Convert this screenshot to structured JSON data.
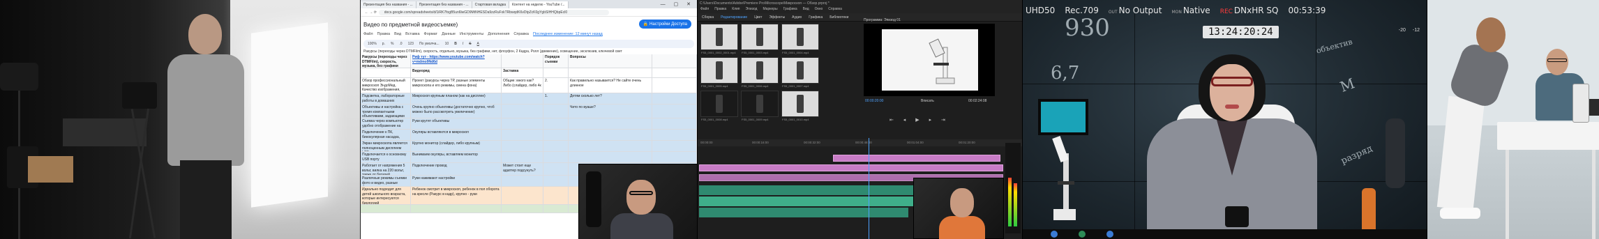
{
  "spreadsheet": {
    "tabs": [
      "Презентация без названия - ...",
      "Презентация без названия - ...",
      "Стартовая вкладка",
      "Контент на неделю - YouTube /..."
    ],
    "url": "docs.google.com/spreadsheets/d/1iRK7fogB5un6lwGD9MtNHESDa9zzRuFxkTRbwqdK6vDtpZcK0gYgbSIHHQbpEcl0",
    "title": "Видео по предметной видеосъемке)",
    "share_label": "Настройки Доступа",
    "menu": [
      "Файл",
      "Правка",
      "Вид",
      "Вставка",
      "Формат",
      "Данные",
      "Инструменты",
      "Дополнения",
      "Справка"
    ],
    "last_edit": "Последнее изменение: 12 минут назад",
    "toolbar": [
      "100%",
      "р.",
      "%",
      ".0",
      "123",
      "По умолча...",
      "10",
      "B",
      "I",
      "S",
      "A"
    ],
    "formula": "Ракурсы (переходы через DTMFilm), скорость, отдельно, музыка, без графики, нет, флоуфон, 2 Кадра, Ролл (движение), освещение, эксклюзив, ключевой свет",
    "headers": [
      "Ракурсы (переходы через DTMFilm), скорость, музыка, без графики",
      "Риф тут - https://www.youtube.com/watch?v=mdmo9Nd6d",
      "",
      "Порядок съемки",
      "Вопросы",
      ""
    ],
    "subheaders": [
      "",
      "Видеоряд",
      "Заставка",
      "",
      "",
      ""
    ],
    "rows": [
      {
        "c1": "Обзор профессиональный микроскоп ЭндоМед. Качество изображения, наличие, отзывы",
        "c2": "Проект (ракурсы через TP, разные элементы микроскопа и его режимы, смена фона)",
        "c3": "Общие: много как? Либо (слайдер, либо 4к",
        "c4": "2.",
        "c5": "Как правильно называется? Не сайте очень длинное",
        "color": ""
      },
      {
        "c1": "Подсветка, лабораторные работы в домашних условиях, медицинская лаборатория",
        "c2": "Микроскоп крупным планом (как на дисплее)",
        "c3": "",
        "c4": "1.",
        "c5": "Детям сколько лет?",
        "color": "blue"
      },
      {
        "c1": "Объективы и настройка с тремя компактными объективами, задающими увеличение",
        "c2": "Очень крупно объективы (достаточно крупно, чтоб можно было рассмотреть увеличение)",
        "c3": "",
        "c4": "",
        "c5": "Чито по вуаше?",
        "color": "blue"
      },
      {
        "c1": "Съемка через компьютер удобно отображение на широком полотне",
        "c2": "Руки крутят объективы",
        "c3": "",
        "c4": "",
        "c5": "",
        "color": "blue"
      },
      {
        "c1": "Подключение к ПК, бинокулярная насадка, мультимедиа",
        "c2": "Окуляры вставляются в микроскоп",
        "c3": "",
        "c4": "",
        "c5": "",
        "color": "blue"
      },
      {
        "c1": "Экран микроскопа является полноценным дисплеем LCD",
        "c2": "Крупно монитор (слайдер, либо крупным)",
        "c3": "",
        "c4": "",
        "c5": "",
        "color": "blue"
      },
      {
        "c1": "Подключается к основному USB порту",
        "c2": "Вынимаем окуляры, вставляем монитор",
        "c3": "",
        "c4": "",
        "c5": "",
        "color": "blue"
      },
      {
        "c1": "Работает от напряжения 5 вольт, вилка на 220 вольт, также от батарей",
        "c2": "Подключение провод",
        "c3": "Может стоит еще адаптер подсунуть?",
        "c4": "",
        "c5": "",
        "color": "blue"
      },
      {
        "c1": "Различные режимы съемки фото и видео, разные форматы",
        "c2": "Руки нажимают настройки",
        "c3": "",
        "c4": "",
        "c5": "",
        "color": "blue"
      },
      {
        "c1": "Идеально подходит для детей школьного возраста, которые интересуются биологией",
        "c2": "Ребенок смотрит в микроскоп, ребенок в пол оборота на кресле (Ракурс в кадр), крупно - руки",
        "c3": "",
        "c4": "",
        "c5": "",
        "color": "orange"
      },
      {
        "c1": "",
        "c2": "",
        "c3": "",
        "c4": "",
        "c5": "",
        "color": "green"
      }
    ]
  },
  "premiere": {
    "title": "C:\\Users\\Documents\\Adobe\\Premiere Pro\\Microscope\\Микроскоп — Обзор.prproj *",
    "menu": [
      "Файл",
      "Правка",
      "Клип",
      "Эпизод",
      "Маркеры",
      "Графика",
      "Вид",
      "Окно",
      "Справка"
    ],
    "workspaces": [
      "Сборка",
      "Редактирование",
      "Цвет",
      "Эффекты",
      "Аудио",
      "Графика",
      "Библиотеки"
    ],
    "bin_label": "Эпизод 01",
    "thumb_labels": [
      "FS5_0001_0002_0001.mp4",
      "FS5_0001_0003.mp4",
      "FS5_0001_0004.mp4",
      "FS5_0001_0005.mp4",
      "FS5_0001_0006.mp4",
      "FS5_0001_0007.mp4",
      "FS5_0001_0008.mp4",
      "FS5_0001_0009.mp4",
      "FS5_0001_0010.mp4"
    ],
    "program_label": "Программа: Эпизод 01",
    "tc_current": "00:00:20:00",
    "tc_duration": "00:02:24:08",
    "fit_label": "Вписать",
    "ruler": [
      "00:00:00",
      "00:00:16:00",
      "00:00:32:00",
      "00:00:48:00",
      "00:01:04:00",
      "00:01:20:00",
      "00:01:36:00"
    ]
  },
  "monitor": {
    "hud": [
      {
        "label": "",
        "value": "UHD50"
      },
      {
        "label": "Rec.709",
        "value": ""
      },
      {
        "label": "OUT",
        "value": "No Output"
      },
      {
        "label": "MON",
        "value": "Native"
      },
      {
        "label": "REC",
        "value": "DNxHR SQ"
      },
      {
        "label": "",
        "value": "00:53:39"
      }
    ],
    "timecode": "13:24:20:24",
    "chalk": [
      "930",
      "6,7",
      "M",
      "разряд",
      "объектив"
    ],
    "audio_db": [
      "-20",
      "-12"
    ]
  },
  "colors": {
    "accent_blue": "#1a73e8",
    "premiere_blue": "#4ea3ff",
    "clip_video": "#c87cc6",
    "clip_audio": "#2f8a70",
    "rec_red": "#ff3b3b"
  }
}
